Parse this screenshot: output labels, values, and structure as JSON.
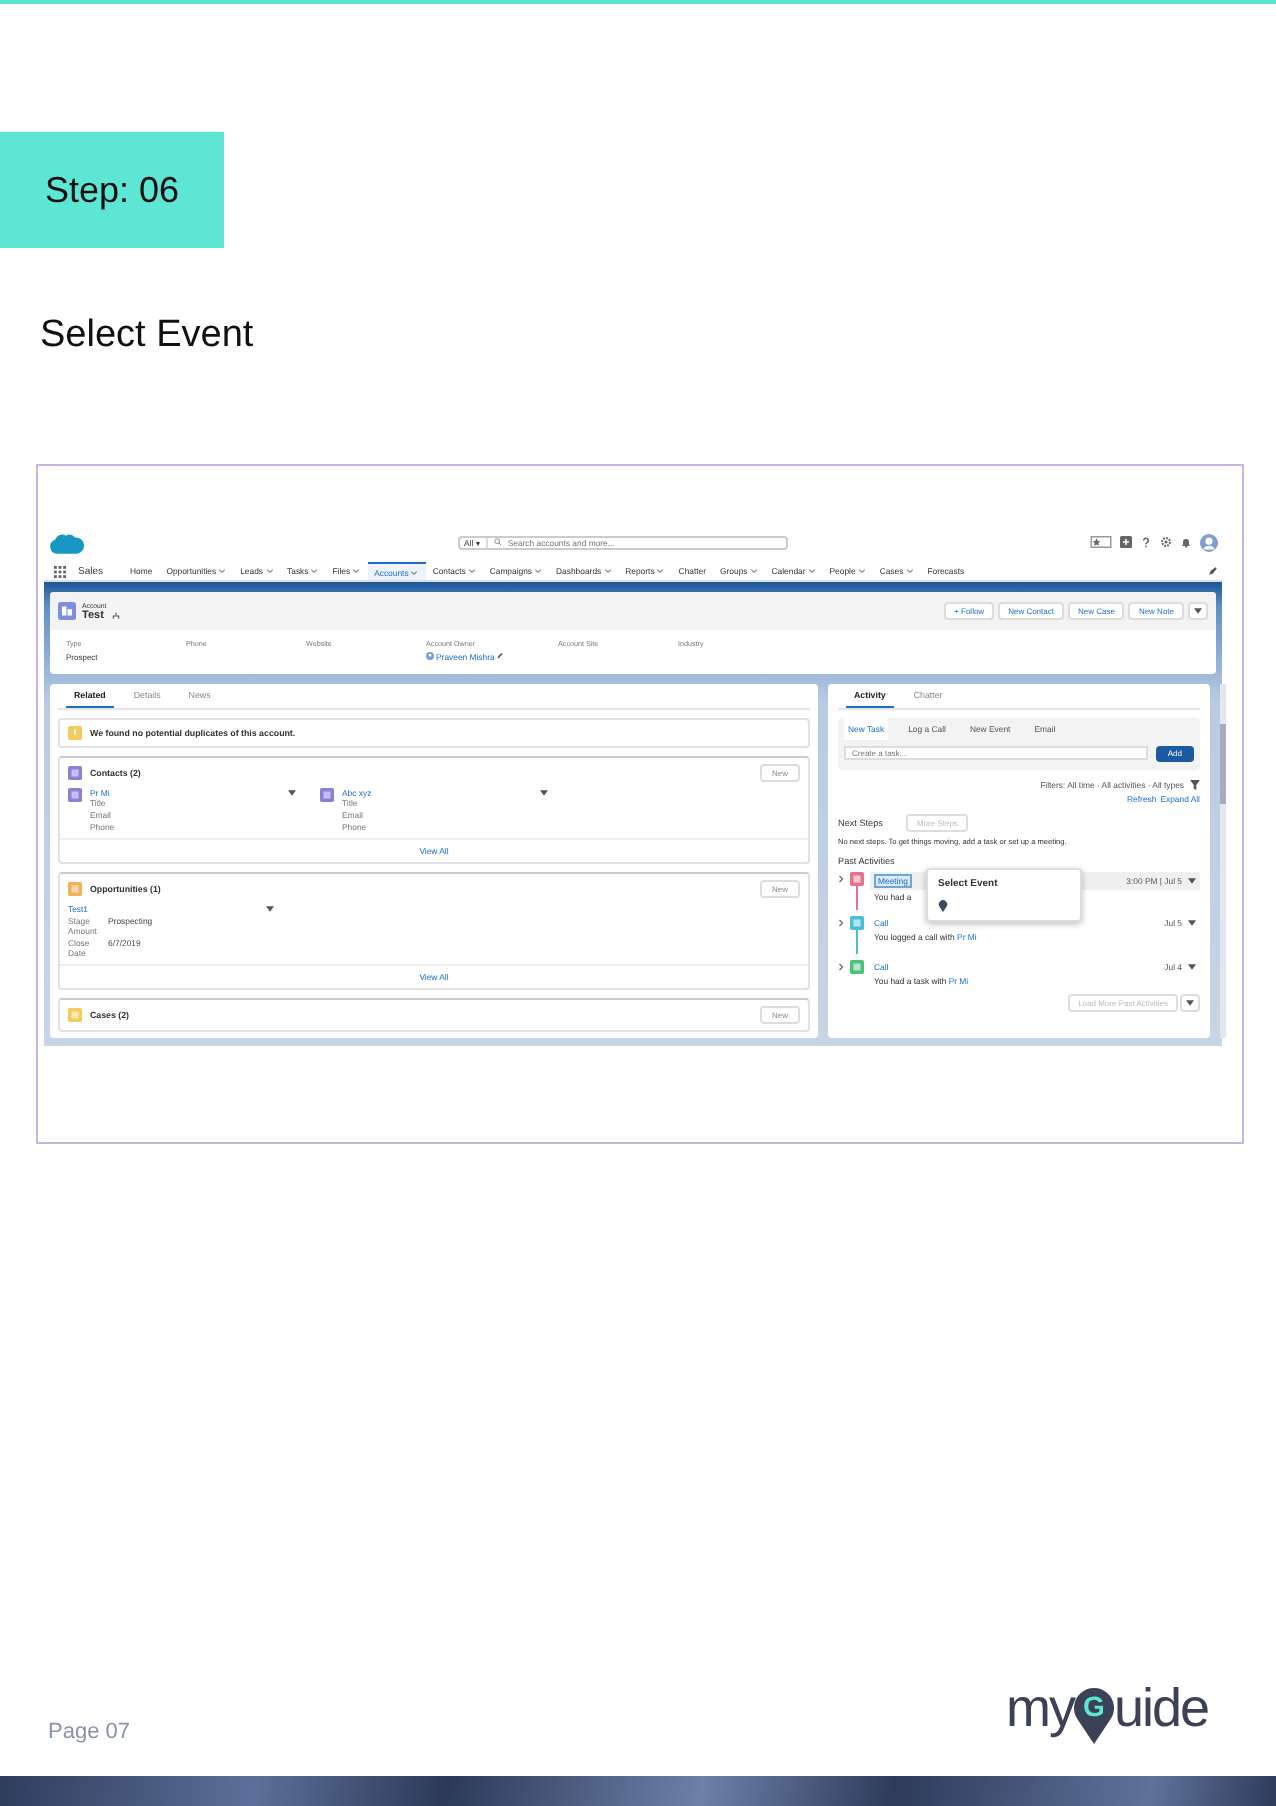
{
  "step_badge": "Step: 06",
  "instruction": "Select Event",
  "screenshot": {
    "search": {
      "scope": "All ▾",
      "placeholder": "Search accounts and more..."
    },
    "app_name": "Sales",
    "nav": [
      {
        "label": "Home",
        "dropdown": false,
        "selected": false
      },
      {
        "label": "Opportunities",
        "dropdown": true,
        "selected": false
      },
      {
        "label": "Leads",
        "dropdown": true,
        "selected": false
      },
      {
        "label": "Tasks",
        "dropdown": true,
        "selected": false
      },
      {
        "label": "Files",
        "dropdown": true,
        "selected": false
      },
      {
        "label": "Accounts",
        "dropdown": true,
        "selected": true
      },
      {
        "label": "Contacts",
        "dropdown": true,
        "selected": false
      },
      {
        "label": "Campaigns",
        "dropdown": true,
        "selected": false
      },
      {
        "label": "Dashboards",
        "dropdown": true,
        "selected": false
      },
      {
        "label": "Reports",
        "dropdown": true,
        "selected": false
      },
      {
        "label": "Chatter",
        "dropdown": false,
        "selected": false
      },
      {
        "label": "Groups",
        "dropdown": true,
        "selected": false
      },
      {
        "label": "Calendar",
        "dropdown": true,
        "selected": false
      },
      {
        "label": "People",
        "dropdown": true,
        "selected": false
      },
      {
        "label": "Cases",
        "dropdown": true,
        "selected": false
      },
      {
        "label": "Forecasts",
        "dropdown": false,
        "selected": false
      }
    ],
    "record": {
      "type_label": "Account",
      "name": "Test",
      "actions": [
        "+ Follow",
        "New Contact",
        "New Case",
        "New Note"
      ],
      "fields": [
        {
          "label": "Type",
          "value": "Prospect"
        },
        {
          "label": "Phone"
        },
        {
          "label": "Website"
        },
        {
          "label": "Account Owner",
          "value": "Praveen Mishra",
          "kind": "owner"
        },
        {
          "label": "Account Site"
        },
        {
          "label": "Industry"
        }
      ]
    },
    "left_tabs": [
      {
        "label": "Related",
        "selected": true
      },
      {
        "label": "Details",
        "selected": false
      },
      {
        "label": "News",
        "selected": false
      }
    ],
    "duplicate_alert": "We found no potential duplicates of this account.",
    "related_lists": [
      {
        "title": "Contacts (2)",
        "color": "#8b80d9",
        "button": "New",
        "footer": "View All",
        "records": [
          {
            "name": "Pr Mi",
            "icon": true,
            "fields": [
              {
                "label": "Title"
              },
              {
                "label": "Email"
              },
              {
                "label": "Phone"
              }
            ]
          },
          {
            "name": "Abc xyz",
            "icon": true,
            "fields": [
              {
                "label": "Title"
              },
              {
                "label": "Email"
              },
              {
                "label": "Phone"
              }
            ]
          }
        ]
      },
      {
        "title": "Opportunities (1)",
        "color": "#f2b15a",
        "button": "New",
        "footer": "View All",
        "records": [
          {
            "name": "Test1",
            "icon": false,
            "fields": [
              {
                "label": "Stage",
                "value": "Prospecting"
              },
              {
                "label": "Amount"
              },
              {
                "label": "Close Date",
                "value": "6/7/2019"
              }
            ]
          }
        ]
      },
      {
        "title": "Cases (2)",
        "color": "#f4cc5e",
        "button": "New"
      }
    ],
    "activity": {
      "tabs": [
        {
          "label": "Activity",
          "selected": true
        },
        {
          "label": "Chatter",
          "selected": false
        }
      ],
      "composer_tabs": [
        {
          "label": "New Task",
          "selected": true
        },
        {
          "label": "Log a Call",
          "selected": false
        },
        {
          "label": "New Event",
          "selected": false
        },
        {
          "label": "Email",
          "selected": false
        }
      ],
      "composer_placeholder": "Create a task...",
      "add_button": "Add",
      "filters": "Filters: All time · All activities · All types",
      "links": [
        "Refresh",
        "Expand All"
      ],
      "next_steps_title": "Next Steps",
      "more_steps_button": "More Steps",
      "no_steps_text": "No next steps. To get things moving, add a task or set up a meeting.",
      "past_title": "Past Activities",
      "items": [
        {
          "title": "Meeting",
          "color": "#e2728e",
          "subtitle": "You had a",
          "date": "3:00 PM | Jul 5",
          "selected": true
        },
        {
          "title": "Call",
          "color": "#4bbfd8",
          "subtitle": "You logged a call with ",
          "contact": "Pr Mi",
          "date": "Jul 5",
          "selected": false
        },
        {
          "title": "Call",
          "color": "#4cc17a",
          "subtitle": "You had a task with ",
          "contact": "Pr Mi",
          "date": "Jul 4",
          "selected": false
        }
      ],
      "load_more": "Load More Past Activities"
    },
    "tooltip": {
      "title": "Select Event"
    }
  },
  "page_number": "Page 07",
  "logo": [
    "my",
    "G",
    "uide"
  ]
}
